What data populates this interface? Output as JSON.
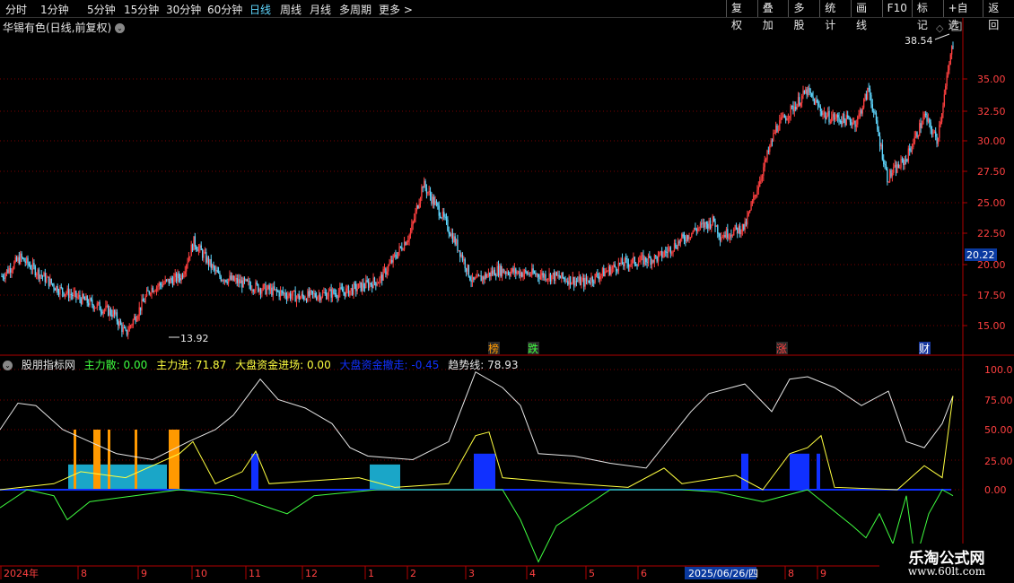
{
  "toolbar": {
    "periods": [
      "分时",
      "1分钟",
      "5分钟",
      "15分钟",
      "30分钟",
      "60分钟",
      "日线",
      "周线",
      "月线",
      "多周期",
      "更多 >"
    ],
    "active": "日线",
    "right_buttons": [
      "复权",
      "叠加",
      "多股",
      "统计",
      "画线",
      "F10",
      "标记",
      "+自选",
      "返回"
    ]
  },
  "chart_title": "华锡有色(日线,前复权)",
  "price_axis": {
    "labels": [
      "35.00",
      "32.50",
      "30.00",
      "27.50",
      "25.00",
      "22.50",
      "20.00",
      "17.50",
      "15.00"
    ],
    "current": "20.22",
    "high_mark": "38.54",
    "low_mark": "13.92"
  },
  "markers": [
    "榜",
    "跌",
    "涨",
    "财"
  ],
  "indicator": {
    "name": "股朋指标网",
    "main_accum": "主力散: 0.00",
    "main_in": "主力进: 71.87",
    "market_in": "大盘资金进场: 0.00",
    "market_out": "大盘资金撤走: -0.45",
    "trend": "趋势线: 78.93",
    "axis": [
      "100.0",
      "75.00",
      "50.00",
      "25.00",
      "0.00"
    ]
  },
  "time_axis": [
    "2024年",
    "8",
    "9",
    "10",
    "11",
    "12",
    "1",
    "2",
    "3",
    "4",
    "5",
    "6",
    "2025/06/26/四",
    "8",
    "9"
  ],
  "watermark": {
    "line1": "乐淘公式网",
    "line2": "www.60lt.com"
  },
  "colors": {
    "up": "#ff4040",
    "down": "#5fd7ff",
    "grid": "#7a0000",
    "axis": "#b00000",
    "trend": "#e6e6e6",
    "yellow": "#ffff40",
    "green": "#40ff40",
    "blue": "#1030ff",
    "cyan": "#1aa6c8",
    "orange": "#ff9900"
  }
}
